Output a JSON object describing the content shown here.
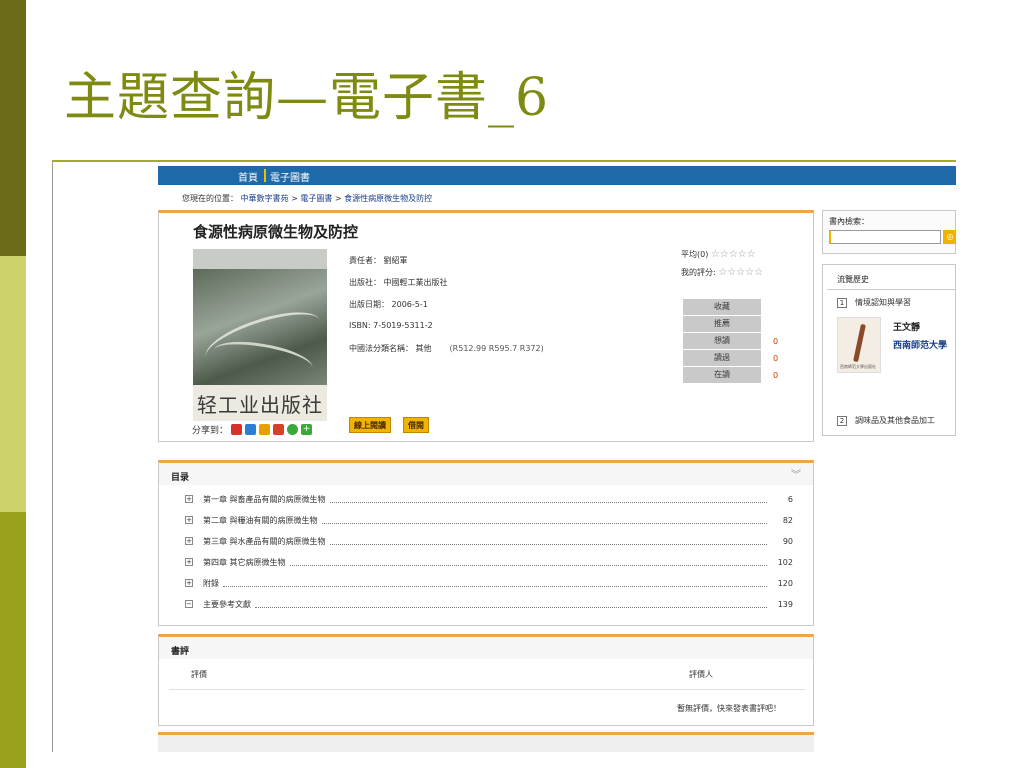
{
  "slide": {
    "title": "主題查詢—電子書_6"
  },
  "topnav": {
    "items": [
      "首頁",
      "電子圖書"
    ]
  },
  "breadcrumb": {
    "prefix": "您現在的位置：",
    "items": [
      "中華數字書苑",
      "電子圖書",
      "食源性病原微生物及防控"
    ],
    "separator": ">"
  },
  "book": {
    "title": "食源性病原微生物及防控",
    "cover_publisher_text": "轻工业出版社",
    "author": "責任者： 劉紹軍",
    "publisher": "出版社： 中國輕工業出版社",
    "pub_date": "出版日期： 2006-5-1",
    "isbn": "ISBN: 7-5019-5311-2",
    "classification": "中國法分類名稱： 其他",
    "class_codes": "(R512.99 R595.7 R372)",
    "read_online_label": "線上閱讀",
    "borrow_label": "借閱",
    "share_label": "分享到："
  },
  "rating": {
    "average_label": "平均(0)",
    "my_rating_label": "我的評分:",
    "stars": "☆☆☆☆☆"
  },
  "actions": [
    {
      "label": "收藏",
      "count": ""
    },
    {
      "label": "推薦",
      "count": ""
    },
    {
      "label": "想讀",
      "count": "0"
    },
    {
      "label": "讀過",
      "count": "0"
    },
    {
      "label": "在讀",
      "count": "0"
    }
  ],
  "sidebar": {
    "search_label": "書內檢索：",
    "search_value": "",
    "history_title": "流覽歷史",
    "history": [
      {
        "num": "1",
        "title": "情境認知與學習"
      },
      {
        "num": "2",
        "title": "調味品及其他食品加工"
      }
    ],
    "thumb_text": "西南師范大學出版社",
    "author": "王文靜",
    "publisher": "西南師范大學"
  },
  "toc": {
    "title": "目录",
    "rows": [
      {
        "expand": "+",
        "title": "第一章 與畜產品有關的病原微生物",
        "page": "6"
      },
      {
        "expand": "+",
        "title": "第二章 與糧油有關的病原微生物",
        "page": "82"
      },
      {
        "expand": "+",
        "title": "第三章 與水產品有關的病原微生物",
        "page": "90"
      },
      {
        "expand": "+",
        "title": "第四章 其它病原微生物",
        "page": "102"
      },
      {
        "expand": "+",
        "title": "附錄",
        "page": "120"
      },
      {
        "expand": "−",
        "title": "主要參考文獻",
        "page": "139"
      }
    ]
  },
  "review": {
    "title": "書評",
    "col_review": "評價",
    "col_reviewer": "評價人",
    "empty_text": "暫無評價，快來發表書評吧！"
  },
  "colors": {
    "nav_blue": "#1e6aa8",
    "accent_orange": "#e8a845",
    "button_yellow": "#f0b400",
    "title_olive": "#7f8a10"
  }
}
